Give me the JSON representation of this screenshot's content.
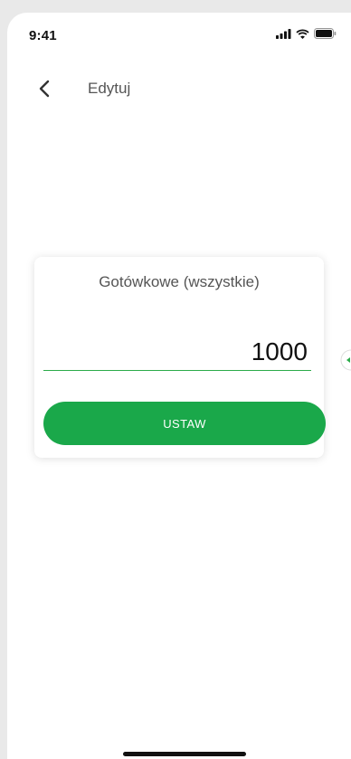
{
  "status_bar": {
    "time": "9:41",
    "icons": [
      "cellular-signal-icon",
      "wifi-icon",
      "battery-icon"
    ]
  },
  "header": {
    "back_icon": "chevron-left-icon",
    "title": "Edytuj"
  },
  "card": {
    "title": "Gotówkowe (wszystkie)",
    "amount_value": "1000",
    "submit_label": "USTAW"
  },
  "colors": {
    "accent": "#1aa84a",
    "underline": "#2cab4a",
    "text_muted": "#555555",
    "background": "#ffffff"
  }
}
